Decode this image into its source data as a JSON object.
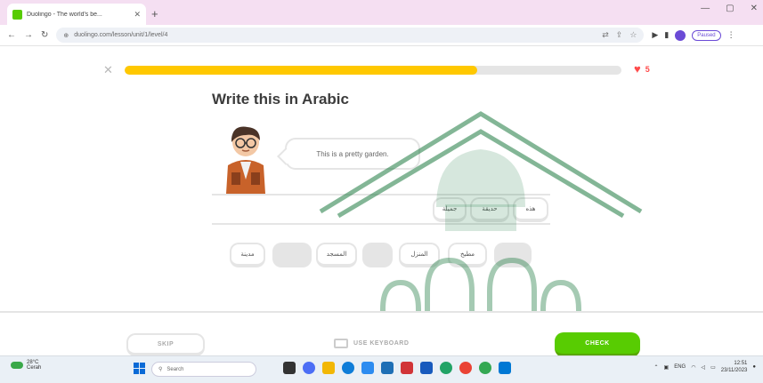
{
  "browser": {
    "tab_title": "Duolingo - The world's be...",
    "url": "duolingo.com/lesson/unit/1/level/4",
    "profile_label": "Paused"
  },
  "lesson": {
    "progress_fraction": 0.71,
    "hearts": "5",
    "title": "Write this in Arabic",
    "prompt": "This is a pretty garden.",
    "answer_chips": [
      "هذه",
      "حديقة",
      "جميلة"
    ],
    "bank_chips": [
      {
        "text": "",
        "used": true
      },
      {
        "text": "مطبخ",
        "used": false
      },
      {
        "text": "المنزل",
        "used": false
      },
      {
        "text": "",
        "used": true
      },
      {
        "text": "المسجد",
        "used": false
      },
      {
        "text": "",
        "used": true
      },
      {
        "text": "مدينة",
        "used": false
      }
    ],
    "skip_label": "SKIP",
    "keyboard_label": "USE KEYBOARD",
    "check_label": "CHECK"
  },
  "taskbar": {
    "weather_temp": "28°C",
    "weather_desc": "Cerah",
    "search_placeholder": "Search",
    "lang": "ENG",
    "time": "12:51",
    "date": "23/11/2023"
  },
  "colors": {
    "progress": "#ffc800",
    "check_button": "#58cc02",
    "heart": "#ff4b4b",
    "watermark": "#1e7a40"
  }
}
